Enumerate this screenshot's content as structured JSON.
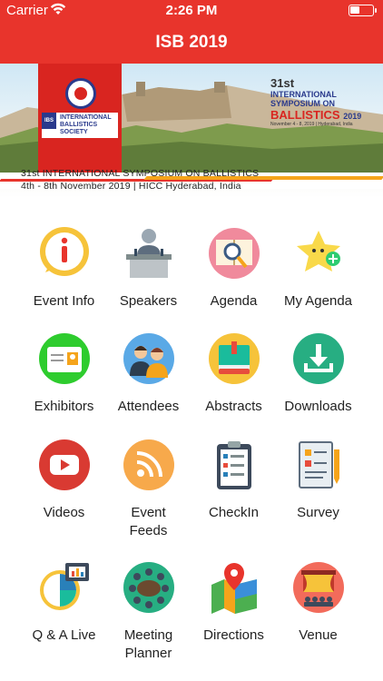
{
  "status": {
    "carrier": "Carrier",
    "time": "2:26 PM"
  },
  "nav": {
    "title": "ISB 2019"
  },
  "banner": {
    "society_short": "IBS",
    "society_line1": "INTERNATIONAL",
    "society_line2": "BALLISTICS SOCIETY",
    "symposium_number": "31st",
    "symposium_line1": "INTERNATIONAL",
    "symposium_line2": "SYMPOSIUM ON",
    "symposium_line3": "BALLISTICS",
    "symposium_year": "2019",
    "symposium_dates": "November 4 - 8, 2019 | Hyderabad, India",
    "caption_line1": "31st INTERNATIONAL SYMPOSIUM ON BALLISTICS",
    "caption_line2": "4th - 8th November 2019 | HICC Hyderabad, India"
  },
  "menu": [
    {
      "label": "Event Info",
      "icon": "event-info-icon"
    },
    {
      "label": "Speakers",
      "icon": "speakers-icon"
    },
    {
      "label": "Agenda",
      "icon": "agenda-icon"
    },
    {
      "label": "My Agenda",
      "icon": "my-agenda-icon"
    },
    {
      "label": "Exhibitors",
      "icon": "exhibitors-icon"
    },
    {
      "label": "Attendees",
      "icon": "attendees-icon"
    },
    {
      "label": "Abstracts",
      "icon": "abstracts-icon"
    },
    {
      "label": "Downloads",
      "icon": "downloads-icon"
    },
    {
      "label": "Videos",
      "icon": "videos-icon"
    },
    {
      "label": "Event\nFeeds",
      "icon": "event-feeds-icon"
    },
    {
      "label": "CheckIn",
      "icon": "checkin-icon"
    },
    {
      "label": "Survey",
      "icon": "survey-icon"
    },
    {
      "label": "Q & A Live",
      "icon": "qa-live-icon"
    },
    {
      "label": "Meeting\nPlanner",
      "icon": "meeting-planner-icon"
    },
    {
      "label": "Directions",
      "icon": "directions-icon"
    },
    {
      "label": "Venue",
      "icon": "venue-icon"
    }
  ],
  "colors": {
    "nav_bg": "#e8342c",
    "accent_red": "#d92520",
    "accent_orange": "#f5a41b",
    "accent_blue": "#2a3a8c"
  }
}
